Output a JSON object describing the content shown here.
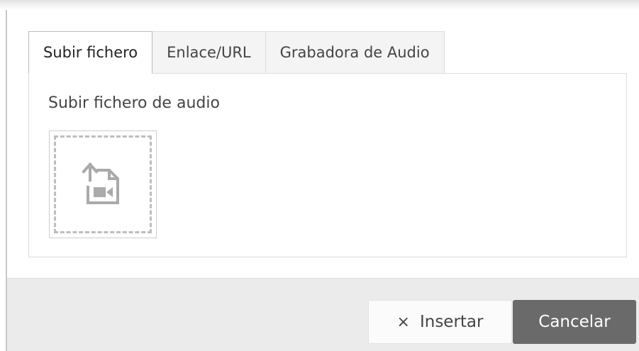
{
  "tabs": [
    {
      "label": "Subir fichero",
      "active": true
    },
    {
      "label": "Enlace/URL",
      "active": false
    },
    {
      "label": "Grabadora de Audio",
      "active": false
    }
  ],
  "panel": {
    "title": "Subir fichero de audio",
    "upload_icon": "file-upload-video-icon"
  },
  "footer": {
    "insert_icon": "×",
    "insert_label": "Insertar",
    "cancel_label": "Cancelar"
  },
  "colors": {
    "footer_bg": "#ebebeb",
    "cancel_bg": "#6a6a6a",
    "dashed_border": "#bdbdbd",
    "tab_inactive_bg": "#f4f4f4"
  }
}
